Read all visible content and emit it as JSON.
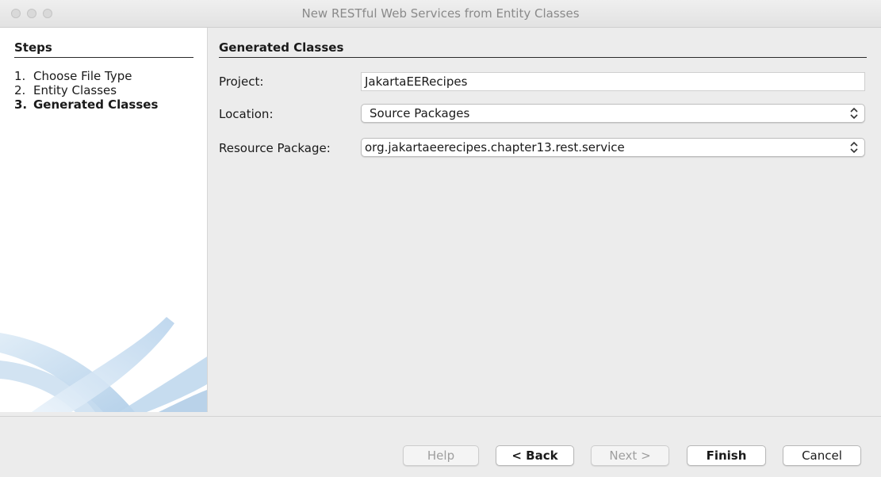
{
  "window": {
    "title": "New RESTful Web Services from Entity Classes"
  },
  "sidebar": {
    "header": "Steps",
    "steps": [
      {
        "num": "1.",
        "label": "Choose File Type"
      },
      {
        "num": "2.",
        "label": "Entity Classes"
      },
      {
        "num": "3.",
        "label": "Generated Classes"
      }
    ]
  },
  "content": {
    "header": "Generated Classes",
    "project_label": "Project:",
    "project_value": "JakartaEERecipes",
    "location_label": "Location:",
    "location_value": "Source Packages",
    "package_label": "Resource Package:",
    "package_value": "org.jakartaeerecipes.chapter13.rest.service"
  },
  "buttons": {
    "help": "Help",
    "back": "< Back",
    "next": "Next >",
    "finish": "Finish",
    "cancel": "Cancel"
  },
  "icons": {
    "select_chevron": "chevron-updown-icon",
    "window_controls": [
      "close-icon",
      "minimize-icon",
      "zoom-icon"
    ]
  }
}
